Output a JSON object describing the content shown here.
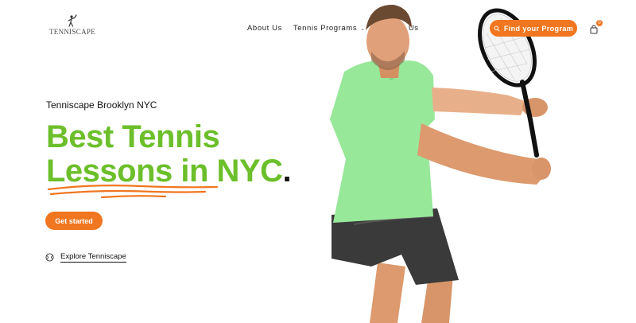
{
  "brand": {
    "name": "TENNISCAPE"
  },
  "nav": {
    "items": [
      {
        "label": "About Us"
      },
      {
        "label": "Tennis Programs"
      },
      {
        "label": "Contact Us"
      }
    ],
    "cta_label": "Find your Program",
    "cart_count": "0"
  },
  "hero": {
    "eyebrow": "Tenniscape Brooklyn NYC",
    "title_line1": "Best Tennis",
    "title_line2": "Lessons in NYC",
    "title_dot": ".",
    "primary_cta": "Get started",
    "explore_label": "Explore Tenniscape"
  },
  "colors": {
    "accent_orange": "#f0761f",
    "title_green": "#6cbf2a",
    "shirt_green": "#98e89a"
  },
  "icons": [
    "tennis-player-logo-icon",
    "chevron-down-icon",
    "search-program-icon",
    "shopping-bag-icon",
    "tennis-ball-icon"
  ]
}
